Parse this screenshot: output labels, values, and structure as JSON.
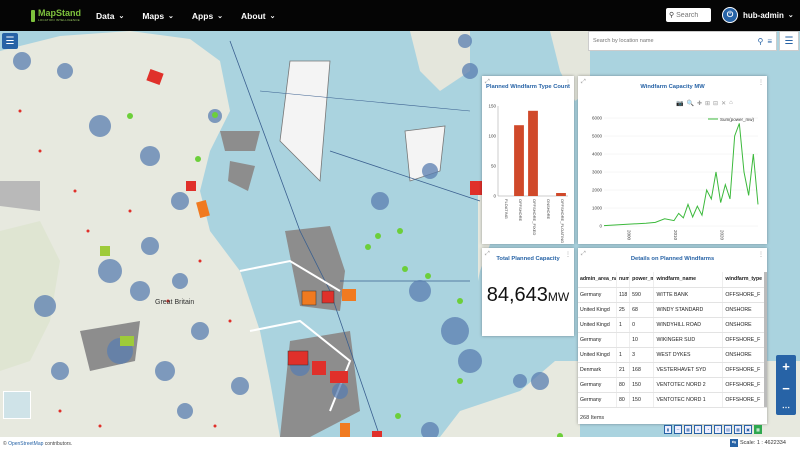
{
  "brand": {
    "name": "MapStand",
    "tagline": "LOCATION INTELLIGENCE"
  },
  "nav": [
    {
      "label": "Data"
    },
    {
      "label": "Maps"
    },
    {
      "label": "Apps"
    },
    {
      "label": "About"
    }
  ],
  "top_search": {
    "placeholder": "Search"
  },
  "user": {
    "name": "hub-admin"
  },
  "map": {
    "location_search_placeholder": "Search by location name",
    "country_label": "Great Britain",
    "colors": {
      "sea": "#aad3df",
      "land": "#e8e8e0",
      "blob": "#5a7db0",
      "windfarm_red": "#e0302a",
      "windfarm_orange": "#f07a20",
      "lease_grey": "#8d8d8d",
      "greenpoint": "#6ccf3a"
    }
  },
  "panels": {
    "type_count": {
      "title": "Planned Windfarm Type Count"
    },
    "capacity": {
      "title": "Windfarm Capacity MW"
    },
    "total": {
      "title": "Total Planned Capacity",
      "value": "84,643",
      "unit": "MW"
    },
    "details": {
      "title": "Details on Planned Windfarms",
      "columns": [
        "admin_area_na",
        "number",
        "power_mw",
        "windfarm_name",
        "windfarm_type"
      ],
      "rows": [
        [
          "Germany",
          "118",
          "590",
          "WITTE BANK",
          "OFFSHORE_F"
        ],
        [
          "United Kingd",
          "25",
          "68",
          "WINDY STANDARD",
          "ONSHORE"
        ],
        [
          "United Kingd",
          "1",
          "0",
          "WINDYHILL ROAD",
          "ONSHORE"
        ],
        [
          "Germany",
          "",
          "10",
          "WIKINGER SUD",
          "OFFSHORE_F"
        ],
        [
          "United Kingd",
          "1",
          "3",
          "WEST DYKES",
          "ONSHORE"
        ],
        [
          "Denmark",
          "21",
          "168",
          "VESTERHAVET SYD",
          "OFFSHORE_F"
        ],
        [
          "Germany",
          "80",
          "150",
          "VENTOTEC NORD 2",
          "OFFSHORE_F"
        ],
        [
          "Germany",
          "80",
          "150",
          "VENTOTEC NORD 1",
          "OFFSHORE_F"
        ]
      ],
      "footer": "268 Items"
    }
  },
  "bottom": {
    "attribution_link": "OpenStreetMap",
    "attribution_rest": " contributors.",
    "scale_label": "Scale",
    "scale_value": "1 : 4622334"
  },
  "chart_data": [
    {
      "type": "bar",
      "title": "Planned Windfarm Type Count",
      "categories": [
        "FLOATING",
        "OFFSHORE",
        "OFFSHORE_FIXED",
        "ONSHORE",
        "OFFSHORE_FLOATING"
      ],
      "values": [
        0,
        118,
        142,
        0,
        5
      ],
      "ylim": [
        0,
        150
      ],
      "yticks": [
        0,
        50,
        100,
        150
      ],
      "color": "#d0492a"
    },
    {
      "type": "line",
      "title": "Windfarm Capacity MW",
      "series": [
        {
          "name": "Sum(power_mw)",
          "x": [
            1995,
            2000,
            2004,
            2006,
            2008,
            2010,
            2011,
            2012,
            2013,
            2014,
            2015,
            2016,
            2017,
            2018,
            2019,
            2020,
            2021,
            2022,
            2023,
            2024,
            2025,
            2026,
            2027,
            2028
          ],
          "y": [
            20,
            100,
            150,
            200,
            400,
            300,
            700,
            450,
            1200,
            500,
            1100,
            600,
            2000,
            1500,
            3000,
            1300,
            2300,
            1500,
            5000,
            5700,
            3000,
            1700,
            4000,
            1200
          ]
        }
      ],
      "xticks": [
        2000,
        2010,
        2020
      ],
      "ylim": [
        0,
        6000
      ],
      "yticks": [
        0,
        1000,
        2000,
        3000,
        4000,
        5000,
        6000
      ],
      "color": "#3cb93c"
    }
  ]
}
